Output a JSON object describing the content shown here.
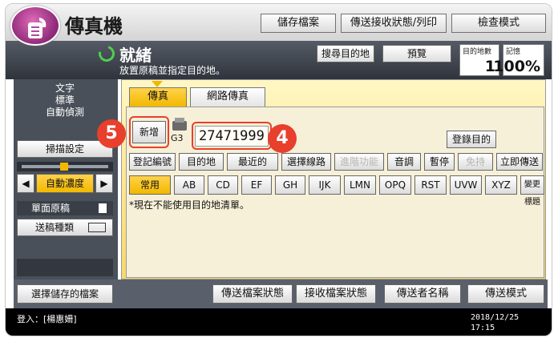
{
  "header": {
    "title": "傳真機",
    "buttons": [
      "儲存檔案",
      "傳送接收狀態/列印",
      "檢查模式"
    ]
  },
  "status": {
    "title": "就緒",
    "message": "放置原稿並指定目的地。",
    "search_dest": "搜尋目的地",
    "preview": "預覽",
    "dest_count_label": "目的地數",
    "dest_count_value": "1",
    "memory_label": "記憶",
    "memory_value": "100%"
  },
  "left_panel": {
    "mode_lines": [
      "文字",
      "標準",
      "自動偵測"
    ],
    "scan_settings": "掃描設定",
    "auto_density": "自動濃度",
    "single_original": "單面原稿",
    "send_type": "送稿種類",
    "select_stored_file": "選擇儲存的檔案"
  },
  "tabs": {
    "fax": "傳真",
    "internet_fax": "網路傳真"
  },
  "destination": {
    "new_button": "新增",
    "line_label": "G3",
    "number": "27471999",
    "register_button": "登錄目的"
  },
  "function_buttons": [
    "登記編號",
    "目的地",
    "最近的",
    "選擇線路",
    "進階功能",
    "音調",
    "暫停",
    "免持",
    "立即傳送"
  ],
  "address_tabs": [
    "常用",
    "AB",
    "CD",
    "EF",
    "GH",
    "IJK",
    "LMN",
    "OPQ",
    "RST",
    "UVW",
    "XYZ",
    "變更標題"
  ],
  "notice": "*現在不能使用目的地清單。",
  "bottom_buttons": [
    "傳送檔案狀態",
    "接收檔案狀態",
    "傳送者名稱",
    "傳送模式"
  ],
  "footer": {
    "login": "登入：[楊惠姍]",
    "date": "2018/12/25",
    "time": "17:15"
  },
  "callouts": {
    "number_step": "4",
    "new_step": "5"
  },
  "colors": {
    "accent_yellow": "#f2b800",
    "callout_red": "#e8402c",
    "status_bg": "#2f343c"
  }
}
